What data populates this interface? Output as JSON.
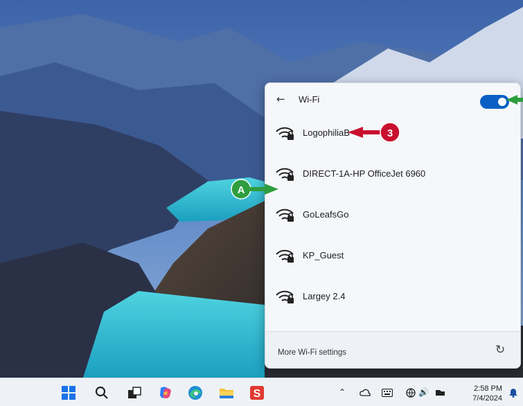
{
  "wifi_panel": {
    "title": "Wi-Fi",
    "toggle_on": true,
    "networks": [
      {
        "name": "LogophiliaB",
        "secured": true
      },
      {
        "name": "DIRECT-1A-HP OfficeJet 6960",
        "secured": true
      },
      {
        "name": "GoLeafsGo",
        "secured": true
      },
      {
        "name": "KP_Guest",
        "secured": true
      },
      {
        "name": "Largey 2.4",
        "secured": true
      }
    ],
    "footer_link": "More Wi-Fi settings"
  },
  "callouts": {
    "step": "3",
    "label_a": "A"
  },
  "taskbar": {
    "icons": [
      "windows-start-icon",
      "search-icon",
      "task-view-icon",
      "copilot-icon",
      "edge-icon",
      "file-explorer-icon",
      "snagit-icon"
    ],
    "tray_icons": [
      "chevron-up-icon",
      "cloud-icon",
      "keyboard-icon",
      "network-icon",
      "speaker-icon",
      "battery-icon",
      "notification-bell-icon"
    ],
    "time": "2:58 PM",
    "date": "7/4/2024"
  },
  "colors": {
    "accent": "#0a5fc4",
    "callout_green": "#2e9e3e",
    "callout_red": "#c8102e",
    "lake": "#35c6d6"
  }
}
